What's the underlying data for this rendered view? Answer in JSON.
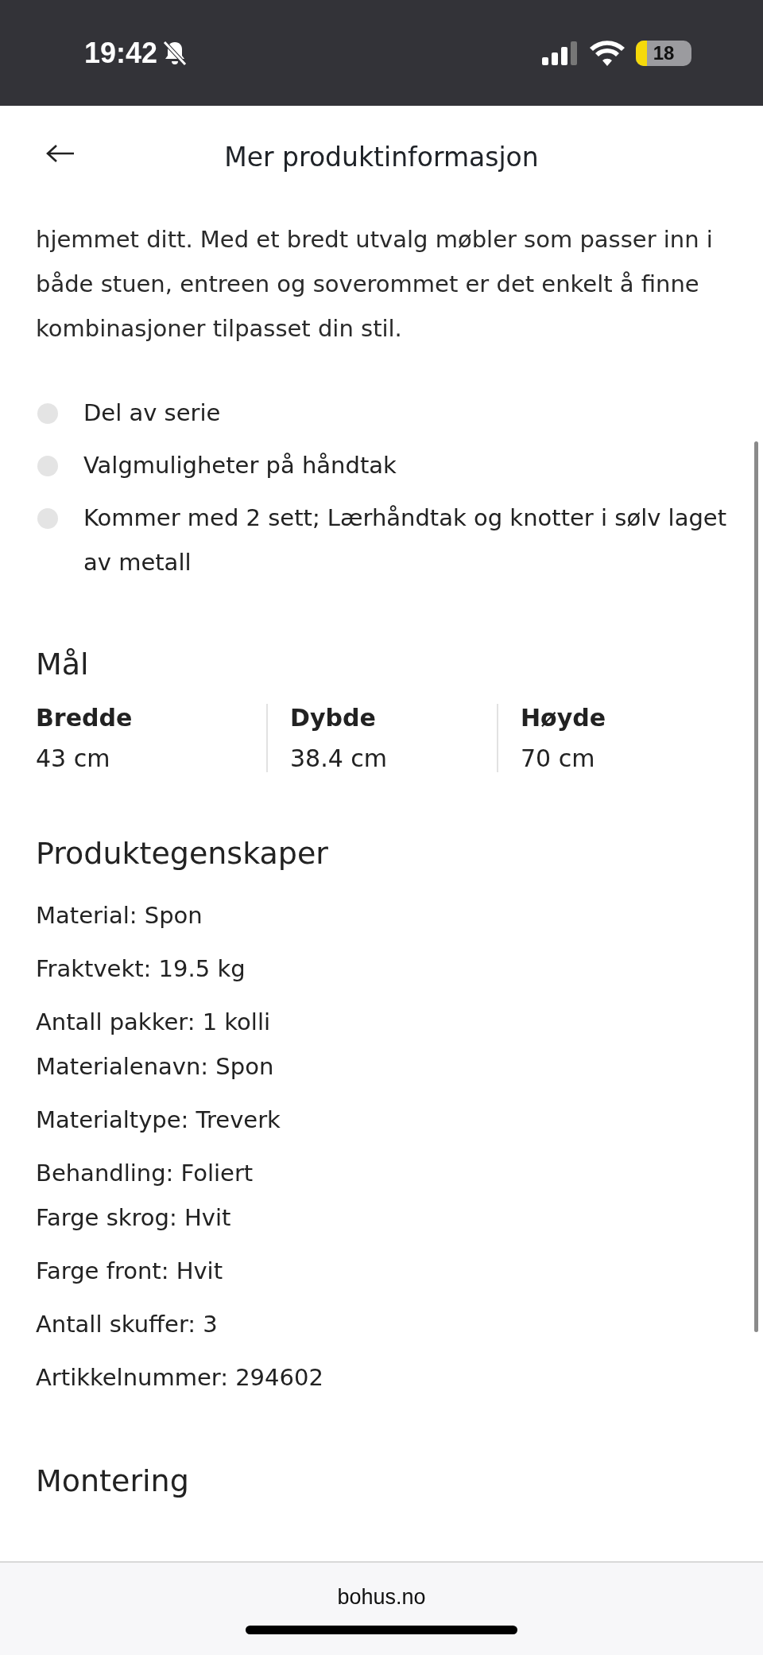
{
  "status_bar": {
    "time": "19:42",
    "battery": "18"
  },
  "header": {
    "title": "Mer produktinformasjon"
  },
  "intro": "hjemmet ditt. Med et bredt utvalg møbler som passer inn i både stuen, entreen og soverommet er det enkelt å finne kombinasjoner tilpasset din stil.",
  "bullets": [
    "Del av serie",
    "Valgmuligheter på håndtak",
    "Kommer med 2 sett; Lærhåndtak og knotter i sølv laget av metall"
  ],
  "dimensions": {
    "title": "Mål",
    "items": [
      {
        "label": "Bredde",
        "value": "43 cm"
      },
      {
        "label": "Dybde",
        "value": "38.4 cm"
      },
      {
        "label": "Høyde",
        "value": "70 cm"
      }
    ]
  },
  "properties": {
    "title": "Produktegenskaper",
    "groups": [
      [
        "Material: Spon"
      ],
      [
        "Fraktvekt: 19.5 kg"
      ],
      [
        "Antall pakker: 1 kolli",
        "Materialenavn: Spon"
      ],
      [
        "Materialtype: Treverk"
      ],
      [
        "Behandling: Foliert",
        "Farge skrog: Hvit"
      ],
      [
        "Farge front: Hvit"
      ],
      [
        "Antall skuffer: 3"
      ],
      [
        "Artikkelnummer: 294602"
      ]
    ]
  },
  "next_section": "Montering",
  "browser_bar": {
    "url": "bohus.no"
  }
}
